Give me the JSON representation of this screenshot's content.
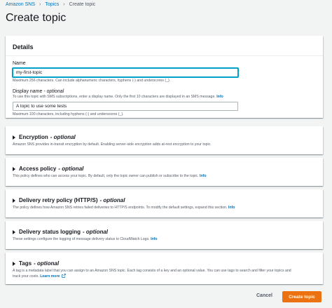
{
  "breadcrumb": {
    "items": [
      "Amazon SNS",
      "Topics",
      "Create topic"
    ]
  },
  "page_title": "Create topic",
  "details": {
    "title": "Details",
    "name": {
      "label": "Name",
      "value": "my-first-topic",
      "hint": "Maximum 256 characters. Can include alphanumeric characters, hyphens (-) and underscores (_)."
    },
    "display_name": {
      "label": "Display name",
      "optional": "- optional",
      "description": "To use this topic with SMS subscriptions, enter a display name. Only the first 10 characters are displayed in an SMS message.",
      "info": "Info",
      "value": "A topic to use some tests",
      "hint": "Maximum 100 characters, including hyphens (-) and underscores (_)."
    }
  },
  "sections": {
    "encryption": {
      "title": "Encryption",
      "optional": "- optional",
      "description": "Amazon SNS provides in-transit encryption by default. Enabling server-side encryption adds at-rest encryption to your topic."
    },
    "access_policy": {
      "title": "Access policy",
      "optional": "- optional",
      "description": "This policy defines who can access your topic. By default, only the topic owner can publish or subscribe to the topic.",
      "info": "Info"
    },
    "delivery_retry": {
      "title": "Delivery retry policy (HTTP/S)",
      "optional": "- optional",
      "description": "The policy defines how Amazon SNS retries failed deliveries to HTTP/S endpoints. To modify the default settings, expand this section.",
      "info": "Info"
    },
    "delivery_logging": {
      "title": "Delivery status logging",
      "optional": "- optional",
      "description": "These settings configure the logging of message delivery status to CloudWatch Logs.",
      "info": "Info"
    },
    "tags": {
      "title": "Tags",
      "optional": "- optional",
      "description_line1": "A tag is a metadata label that you can assign to an Amazon SNS topic. Each tag consists of a key and an optional value. You can use tags to search and filter your topics and",
      "description_line2": "track your costs.",
      "learn_more": "Learn more"
    }
  },
  "actions": {
    "cancel": "Cancel",
    "create": "Create topic"
  },
  "icons": {
    "external_link": "external-link-icon",
    "expand": "caret-right-icon"
  },
  "colors": {
    "primary_button": "#ec7211",
    "link": "#0073bb",
    "focus": "#00a1c9"
  }
}
